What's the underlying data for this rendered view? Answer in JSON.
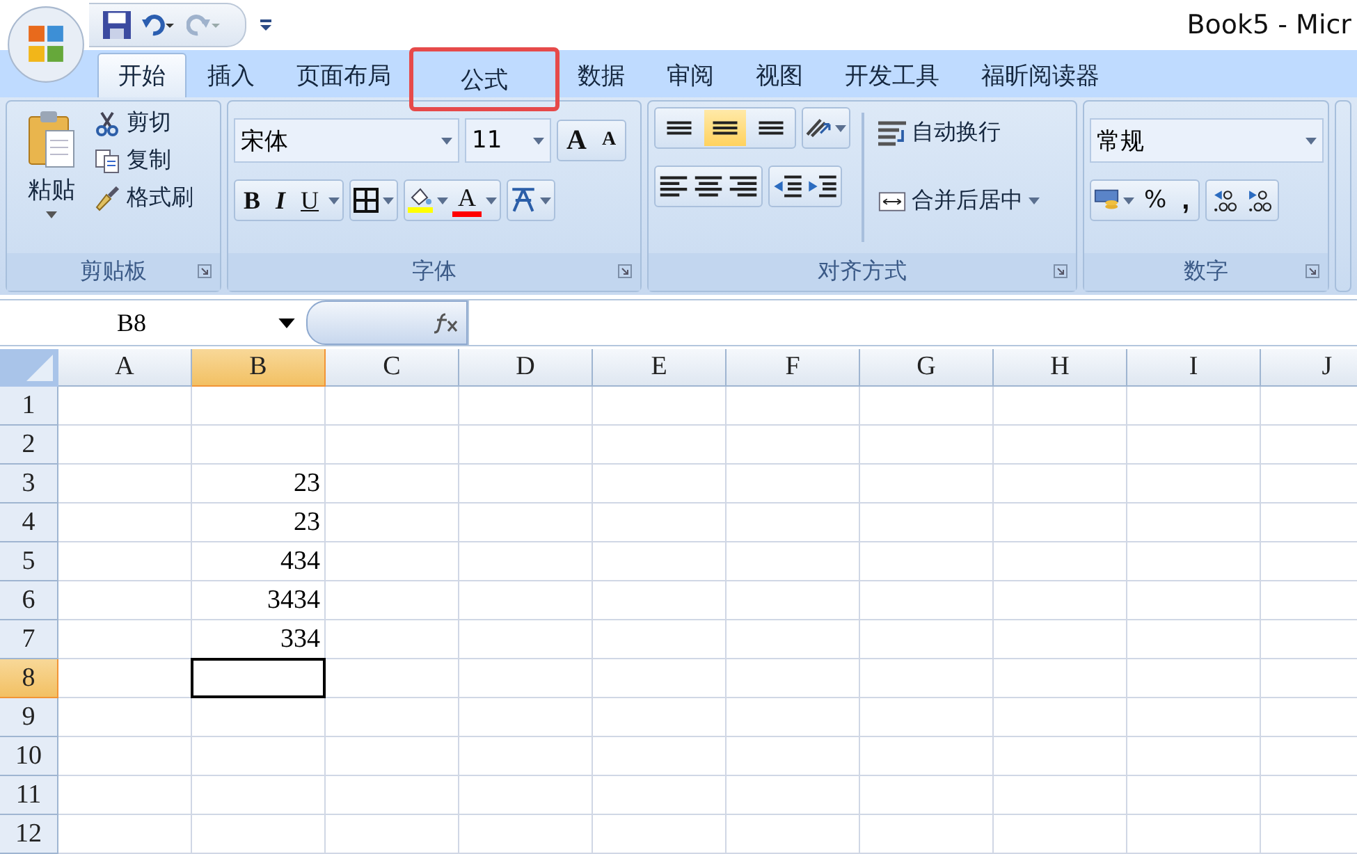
{
  "window": {
    "title": "Book5 - Micr"
  },
  "tabs": [
    {
      "label": "开始",
      "selected": true,
      "highlighted": false
    },
    {
      "label": "插入",
      "selected": false,
      "highlighted": false
    },
    {
      "label": "页面布局",
      "selected": false,
      "highlighted": false
    },
    {
      "label": "公式",
      "selected": false,
      "highlighted": true
    },
    {
      "label": "数据",
      "selected": false,
      "highlighted": false
    },
    {
      "label": "审阅",
      "selected": false,
      "highlighted": false
    },
    {
      "label": "视图",
      "selected": false,
      "highlighted": false
    },
    {
      "label": "开发工具",
      "selected": false,
      "highlighted": false
    },
    {
      "label": "福昕阅读器",
      "selected": false,
      "highlighted": false
    }
  ],
  "clipboard": {
    "paste": "粘贴",
    "items": [
      "剪切",
      "复制",
      "格式刷"
    ],
    "label": "剪贴板"
  },
  "font": {
    "name": "宋体",
    "size": "11",
    "grow": "A",
    "shrink": "A",
    "bold": "B",
    "italic": "I",
    "underline": "U",
    "color_letter": "A",
    "label": "字体"
  },
  "alignment": {
    "vertical": [
      {
        "selected": false
      },
      {
        "selected": true
      },
      {
        "selected": false
      }
    ],
    "wrap": "自动换行",
    "merge": "合并后居中",
    "label": "对齐方式"
  },
  "number": {
    "format": "常规",
    "percent": "%",
    "comma": ",",
    "label": "数字"
  },
  "formula_bar": {
    "name_box": "B8"
  },
  "columns": [
    {
      "label": "A",
      "selected": false
    },
    {
      "label": "B",
      "selected": true
    },
    {
      "label": "C",
      "selected": false
    },
    {
      "label": "D",
      "selected": false
    },
    {
      "label": "E",
      "selected": false
    },
    {
      "label": "F",
      "selected": false
    },
    {
      "label": "G",
      "selected": false
    },
    {
      "label": "H",
      "selected": false
    },
    {
      "label": "I",
      "selected": false
    },
    {
      "label": "J",
      "selected": false
    }
  ],
  "rows": [
    {
      "label": "1",
      "selected": false,
      "cells": []
    },
    {
      "label": "2",
      "selected": false,
      "cells": []
    },
    {
      "label": "3",
      "selected": false,
      "cells": [
        null,
        "23"
      ]
    },
    {
      "label": "4",
      "selected": false,
      "cells": [
        null,
        "23"
      ]
    },
    {
      "label": "5",
      "selected": false,
      "cells": [
        null,
        "434"
      ]
    },
    {
      "label": "6",
      "selected": false,
      "cells": [
        null,
        "3434"
      ]
    },
    {
      "label": "7",
      "selected": false,
      "cells": [
        null,
        "334"
      ]
    },
    {
      "label": "8",
      "selected": true,
      "cells": []
    },
    {
      "label": "9",
      "selected": false,
      "cells": []
    },
    {
      "label": "10",
      "selected": false,
      "cells": []
    },
    {
      "label": "11",
      "selected": false,
      "cells": []
    },
    {
      "label": "12",
      "selected": false,
      "cells": []
    }
  ]
}
